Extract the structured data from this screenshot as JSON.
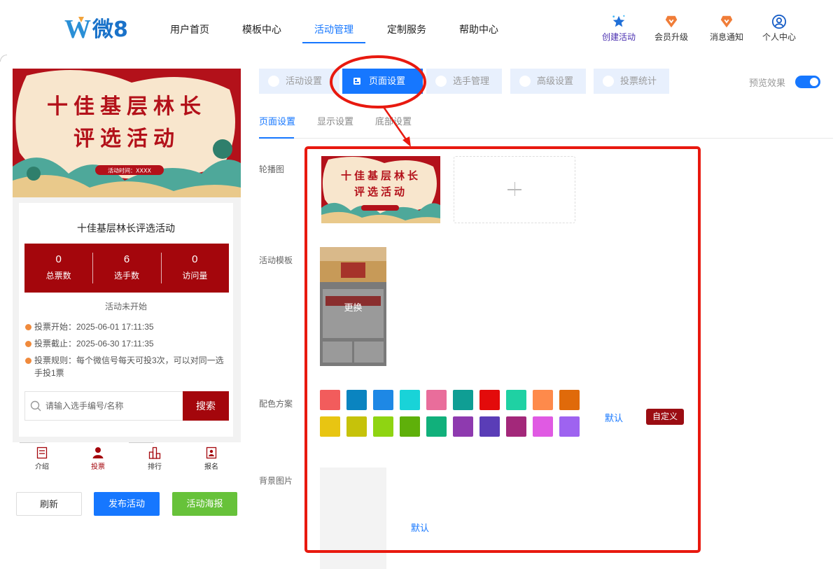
{
  "logo": {
    "w": "W",
    "text": "微8"
  },
  "nav": {
    "items": [
      "用户首页",
      "模板中心",
      "活动管理",
      "定制服务",
      "帮助中心"
    ],
    "active": "活动管理",
    "right": [
      {
        "label": "创建活动",
        "icon": "star-create-icon"
      },
      {
        "label": "会员升级",
        "icon": "vip-badge-icon"
      },
      {
        "label": "消息通知",
        "icon": "message-badge-icon"
      },
      {
        "label": "个人中心",
        "icon": "user-circle-icon"
      }
    ]
  },
  "preview": {
    "banner": {
      "line1": "十佳基层林长",
      "line2": "评选活动",
      "time": "活动时间：XXXX"
    },
    "title": "十佳基层林长评选活动",
    "stats": [
      {
        "value": "0",
        "label": "总票数"
      },
      {
        "value": "6",
        "label": "选手数"
      },
      {
        "value": "0",
        "label": "访问量"
      }
    ],
    "status": "活动未开始",
    "info": {
      "start": "投票开始：2025-06-01 17:11:35",
      "end": "投票截止：2025-06-30 17:11:35",
      "rule": "投票规则：每个微信号每天可投3次，可以对同一选手投1票"
    },
    "search": {
      "placeholder": "请输入选手编号/名称",
      "button": "搜索"
    },
    "tabs": [
      {
        "label": "介绍",
        "icon": "intro-icon"
      },
      {
        "label": "投票",
        "icon": "vote-person-icon"
      },
      {
        "label": "排行",
        "icon": "ranking-icon"
      },
      {
        "label": "报名",
        "icon": "signup-icon"
      }
    ],
    "buttons": {
      "refresh": "刷新",
      "publish": "发布活动",
      "poster": "活动海报"
    }
  },
  "settings": {
    "tabs": [
      "活动设置",
      "页面设置",
      "选手管理",
      "高级设置",
      "投票统计"
    ],
    "active_tab": "页面设置",
    "preview_label": "预览效果",
    "preview_on": true,
    "subtabs": [
      "页面设置",
      "显示设置",
      "底部设置"
    ],
    "active_subtab": "页面设置",
    "labels": {
      "carousel": "轮播图",
      "template": "活动模板",
      "color": "配色方案",
      "background": "背景图片"
    },
    "template_change": "更换",
    "colors": [
      "#f25c5c",
      "#0a84c0",
      "#1e88e5",
      "#19d3d8",
      "#e96d9b",
      "#0f9e94",
      "#e30b0b",
      "#1fd1a3",
      "#fe8a4b",
      "#e06a0a",
      "#e8c512",
      "#c6c20a",
      "#8fd412",
      "#5fb00a",
      "#11b07b",
      "#8e3aaf",
      "#5a3db7",
      "#a3287a",
      "#e05ae3",
      "#9e63f0"
    ],
    "color_default": "默认",
    "color_custom": "自定义",
    "bg_default": "默认"
  }
}
